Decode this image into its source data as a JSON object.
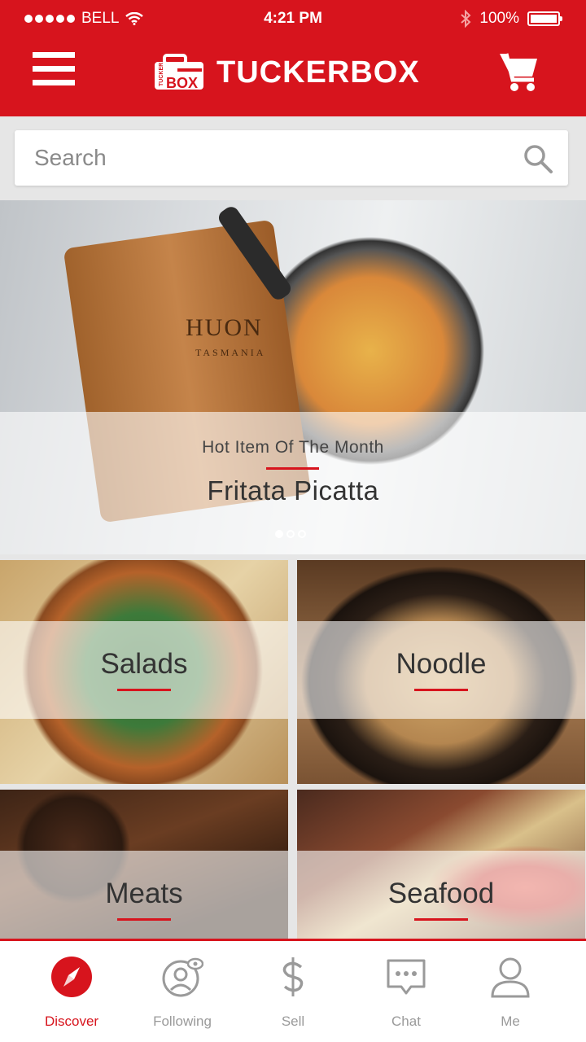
{
  "status_bar": {
    "carrier": "BELL",
    "time": "4:21 PM",
    "battery": "100%"
  },
  "header": {
    "title": "TUCKERBOX",
    "logo_text": "TUCKER BOX"
  },
  "search": {
    "placeholder": "Search"
  },
  "hero": {
    "subtitle": "Hot Item Of The Month",
    "title": "Fritata Picatta",
    "board_brand": "HUON",
    "board_sub": "TASMANIA",
    "page_count": 3,
    "active_page": 1
  },
  "categories": [
    {
      "label": "Salads"
    },
    {
      "label": "Noodle"
    },
    {
      "label": "Meats"
    },
    {
      "label": "Seafood"
    }
  ],
  "tabs": [
    {
      "label": "Discover",
      "icon": "compass-icon",
      "active": true
    },
    {
      "label": "Following",
      "icon": "following-icon",
      "active": false
    },
    {
      "label": "Sell",
      "icon": "dollar-icon",
      "active": false
    },
    {
      "label": "Chat",
      "icon": "chat-icon",
      "active": false
    },
    {
      "label": "Me",
      "icon": "user-icon",
      "active": false
    }
  ],
  "colors": {
    "brand": "#d7141d",
    "tab_inactive": "#9a9a9a"
  }
}
